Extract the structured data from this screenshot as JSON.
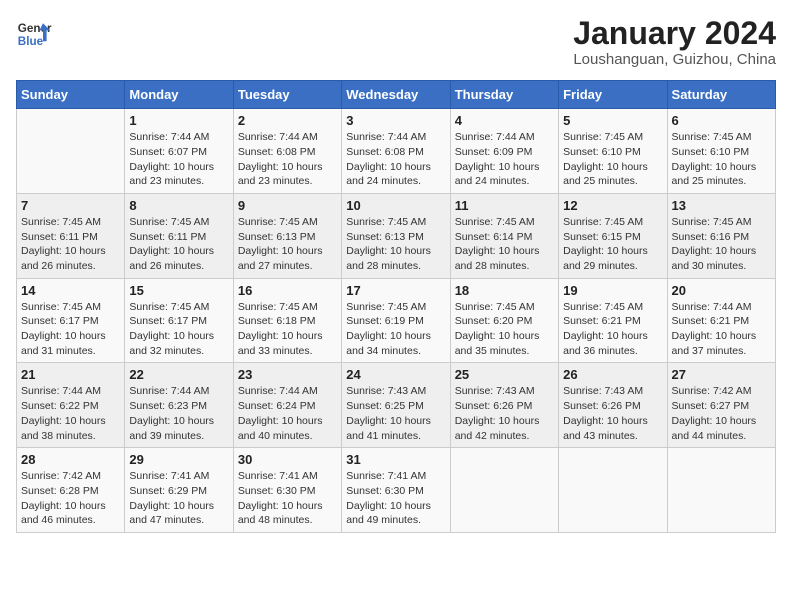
{
  "header": {
    "logo_line1": "General",
    "logo_line2": "Blue",
    "main_title": "January 2024",
    "subtitle": "Loushanguan, Guizhou, China"
  },
  "weekdays": [
    "Sunday",
    "Monday",
    "Tuesday",
    "Wednesday",
    "Thursday",
    "Friday",
    "Saturday"
  ],
  "weeks": [
    [
      {
        "day": "",
        "sunrise": "",
        "sunset": "",
        "daylight": ""
      },
      {
        "day": "1",
        "sunrise": "Sunrise: 7:44 AM",
        "sunset": "Sunset: 6:07 PM",
        "daylight": "Daylight: 10 hours and 23 minutes."
      },
      {
        "day": "2",
        "sunrise": "Sunrise: 7:44 AM",
        "sunset": "Sunset: 6:08 PM",
        "daylight": "Daylight: 10 hours and 23 minutes."
      },
      {
        "day": "3",
        "sunrise": "Sunrise: 7:44 AM",
        "sunset": "Sunset: 6:08 PM",
        "daylight": "Daylight: 10 hours and 24 minutes."
      },
      {
        "day": "4",
        "sunrise": "Sunrise: 7:44 AM",
        "sunset": "Sunset: 6:09 PM",
        "daylight": "Daylight: 10 hours and 24 minutes."
      },
      {
        "day": "5",
        "sunrise": "Sunrise: 7:45 AM",
        "sunset": "Sunset: 6:10 PM",
        "daylight": "Daylight: 10 hours and 25 minutes."
      },
      {
        "day": "6",
        "sunrise": "Sunrise: 7:45 AM",
        "sunset": "Sunset: 6:10 PM",
        "daylight": "Daylight: 10 hours and 25 minutes."
      }
    ],
    [
      {
        "day": "7",
        "sunrise": "Sunrise: 7:45 AM",
        "sunset": "Sunset: 6:11 PM",
        "daylight": "Daylight: 10 hours and 26 minutes."
      },
      {
        "day": "8",
        "sunrise": "Sunrise: 7:45 AM",
        "sunset": "Sunset: 6:11 PM",
        "daylight": "Daylight: 10 hours and 26 minutes."
      },
      {
        "day": "9",
        "sunrise": "Sunrise: 7:45 AM",
        "sunset": "Sunset: 6:13 PM",
        "daylight": "Daylight: 10 hours and 27 minutes."
      },
      {
        "day": "10",
        "sunrise": "Sunrise: 7:45 AM",
        "sunset": "Sunset: 6:13 PM",
        "daylight": "Daylight: 10 hours and 28 minutes."
      },
      {
        "day": "11",
        "sunrise": "Sunrise: 7:45 AM",
        "sunset": "Sunset: 6:14 PM",
        "daylight": "Daylight: 10 hours and 28 minutes."
      },
      {
        "day": "12",
        "sunrise": "Sunrise: 7:45 AM",
        "sunset": "Sunset: 6:15 PM",
        "daylight": "Daylight: 10 hours and 29 minutes."
      },
      {
        "day": "13",
        "sunrise": "Sunrise: 7:45 AM",
        "sunset": "Sunset: 6:16 PM",
        "daylight": "Daylight: 10 hours and 30 minutes."
      }
    ],
    [
      {
        "day": "14",
        "sunrise": "Sunrise: 7:45 AM",
        "sunset": "Sunset: 6:17 PM",
        "daylight": "Daylight: 10 hours and 31 minutes."
      },
      {
        "day": "15",
        "sunrise": "Sunrise: 7:45 AM",
        "sunset": "Sunset: 6:17 PM",
        "daylight": "Daylight: 10 hours and 32 minutes."
      },
      {
        "day": "16",
        "sunrise": "Sunrise: 7:45 AM",
        "sunset": "Sunset: 6:18 PM",
        "daylight": "Daylight: 10 hours and 33 minutes."
      },
      {
        "day": "17",
        "sunrise": "Sunrise: 7:45 AM",
        "sunset": "Sunset: 6:19 PM",
        "daylight": "Daylight: 10 hours and 34 minutes."
      },
      {
        "day": "18",
        "sunrise": "Sunrise: 7:45 AM",
        "sunset": "Sunset: 6:20 PM",
        "daylight": "Daylight: 10 hours and 35 minutes."
      },
      {
        "day": "19",
        "sunrise": "Sunrise: 7:45 AM",
        "sunset": "Sunset: 6:21 PM",
        "daylight": "Daylight: 10 hours and 36 minutes."
      },
      {
        "day": "20",
        "sunrise": "Sunrise: 7:44 AM",
        "sunset": "Sunset: 6:21 PM",
        "daylight": "Daylight: 10 hours and 37 minutes."
      }
    ],
    [
      {
        "day": "21",
        "sunrise": "Sunrise: 7:44 AM",
        "sunset": "Sunset: 6:22 PM",
        "daylight": "Daylight: 10 hours and 38 minutes."
      },
      {
        "day": "22",
        "sunrise": "Sunrise: 7:44 AM",
        "sunset": "Sunset: 6:23 PM",
        "daylight": "Daylight: 10 hours and 39 minutes."
      },
      {
        "day": "23",
        "sunrise": "Sunrise: 7:44 AM",
        "sunset": "Sunset: 6:24 PM",
        "daylight": "Daylight: 10 hours and 40 minutes."
      },
      {
        "day": "24",
        "sunrise": "Sunrise: 7:43 AM",
        "sunset": "Sunset: 6:25 PM",
        "daylight": "Daylight: 10 hours and 41 minutes."
      },
      {
        "day": "25",
        "sunrise": "Sunrise: 7:43 AM",
        "sunset": "Sunset: 6:26 PM",
        "daylight": "Daylight: 10 hours and 42 minutes."
      },
      {
        "day": "26",
        "sunrise": "Sunrise: 7:43 AM",
        "sunset": "Sunset: 6:26 PM",
        "daylight": "Daylight: 10 hours and 43 minutes."
      },
      {
        "day": "27",
        "sunrise": "Sunrise: 7:42 AM",
        "sunset": "Sunset: 6:27 PM",
        "daylight": "Daylight: 10 hours and 44 minutes."
      }
    ],
    [
      {
        "day": "28",
        "sunrise": "Sunrise: 7:42 AM",
        "sunset": "Sunset: 6:28 PM",
        "daylight": "Daylight: 10 hours and 46 minutes."
      },
      {
        "day": "29",
        "sunrise": "Sunrise: 7:41 AM",
        "sunset": "Sunset: 6:29 PM",
        "daylight": "Daylight: 10 hours and 47 minutes."
      },
      {
        "day": "30",
        "sunrise": "Sunrise: 7:41 AM",
        "sunset": "Sunset: 6:30 PM",
        "daylight": "Daylight: 10 hours and 48 minutes."
      },
      {
        "day": "31",
        "sunrise": "Sunrise: 7:41 AM",
        "sunset": "Sunset: 6:30 PM",
        "daylight": "Daylight: 10 hours and 49 minutes."
      },
      {
        "day": "",
        "sunrise": "",
        "sunset": "",
        "daylight": ""
      },
      {
        "day": "",
        "sunrise": "",
        "sunset": "",
        "daylight": ""
      },
      {
        "day": "",
        "sunrise": "",
        "sunset": "",
        "daylight": ""
      }
    ]
  ]
}
